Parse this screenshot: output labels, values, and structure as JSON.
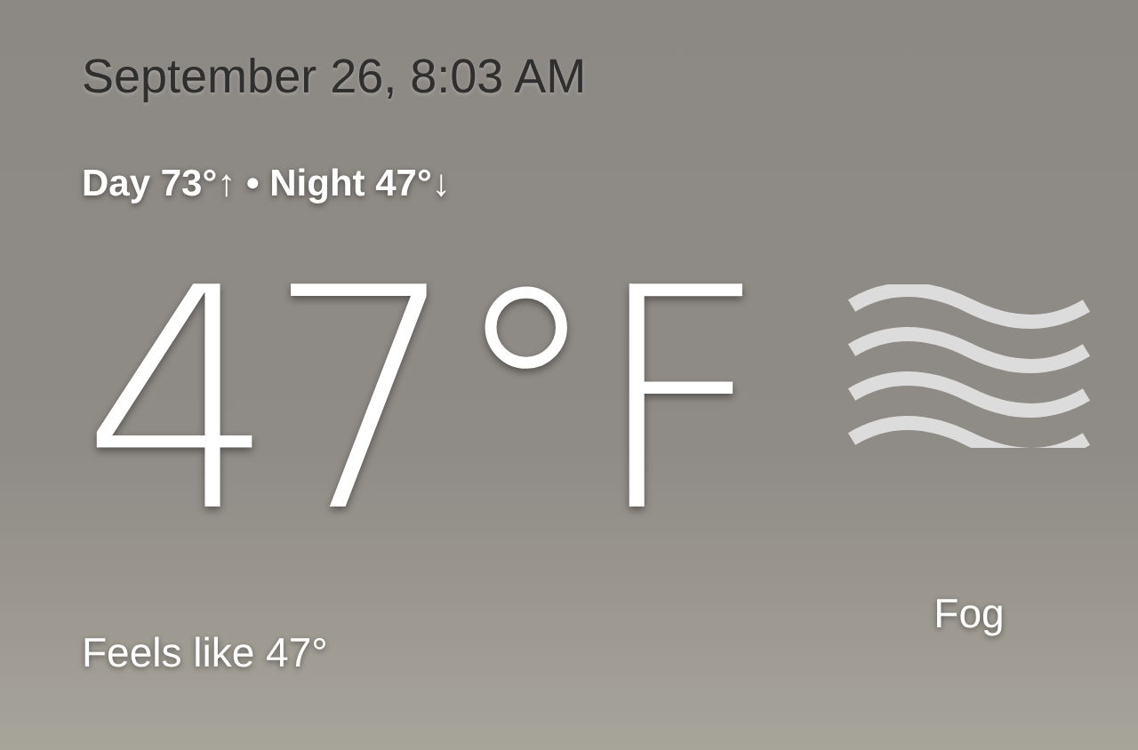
{
  "datetime": "September 26, 8:03 AM",
  "day_night": "Day 73°↑ • Night 47°↓",
  "temperature": "47°F",
  "feels_like": "Feels like 47°",
  "condition": {
    "kind": "fog",
    "label": "Fog"
  }
}
